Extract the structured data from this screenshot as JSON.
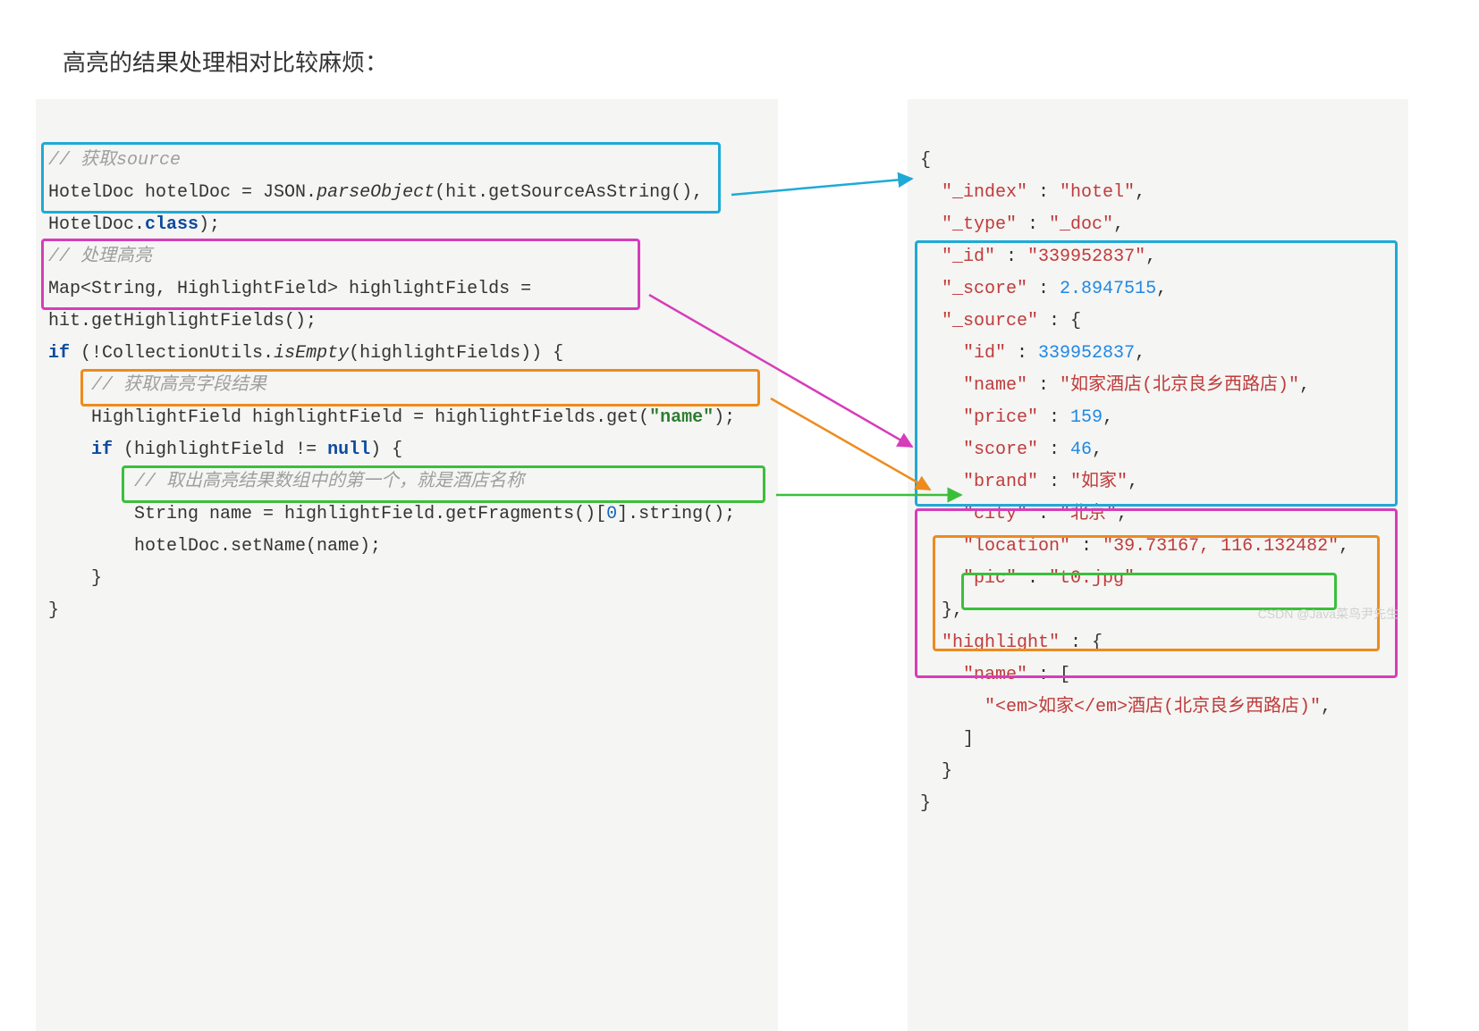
{
  "title": "高亮的结果处理相对比较麻烦：",
  "left": {
    "c1": "// 获取source",
    "l2a": "HotelDoc hotelDoc = JSON.",
    "l2b": "parseObject",
    "l2c": "(hit.getSourceAsString(),",
    "l3a": "HotelDoc.",
    "l3b": "class",
    "l3c": ");",
    "c2": "// 处理高亮",
    "l5": "Map<String, HighlightField> highlightFields =",
    "l6": "hit.getHighlightFields();",
    "l7a": "if",
    "l7b": " (!CollectionUtils.",
    "l7c": "isEmpty",
    "l7d": "(highlightFields)) {",
    "c3": "// 获取高亮字段结果",
    "l9a": "HighlightField highlightField = highlightFields.get(",
    "l9b": "\"name\"",
    "l9c": ");",
    "l10a": "if",
    "l10b": " (highlightField != ",
    "l10c": "null",
    "l10d": ") {",
    "c4": "// 取出高亮结果数组中的第一个，就是酒店名称",
    "l12a": "String name = highlightField.getFragments()[",
    "l12b": "0",
    "l12c": "].string();",
    "l13": "hotelDoc.setName(name);",
    "l14": "}",
    "l15": "}"
  },
  "right": {
    "open": "{",
    "index_k": "\"_index\"",
    "index_v": "\"hotel\"",
    "type_k": "\"_type\"",
    "type_v": "\"_doc\"",
    "id_k": "\"_id\"",
    "id_v": "\"339952837\"",
    "score_k": "\"_score\"",
    "score_v": "2.8947515",
    "source_k": "\"_source\"",
    "sid_k": "\"id\"",
    "sid_v": "339952837",
    "sname_k": "\"name\"",
    "sname_v": "\"如家酒店(北京良乡西路店)\"",
    "sprice_k": "\"price\"",
    "sprice_v": "159",
    "sscore_k": "\"score\"",
    "sscore_v": "46",
    "sbrand_k": "\"brand\"",
    "sbrand_v": "\"如家\"",
    "scity_k": "\"city\"",
    "scity_v": "\"北京\"",
    "sloc_k": "\"location\"",
    "sloc_v": "\"39.73167, 116.132482\"",
    "spic_k": "\"pic\"",
    "spic_v": "\"t0.jpg\"",
    "src_close": "},",
    "hl_k": "\"highlight\"",
    "hlname_k": "\"name\"",
    "hlval": "\"<em>如家</em>酒店(北京良乡西路店)\"",
    "close_br": "]",
    "close_obj": "}",
    "close_all": "}"
  },
  "watermark": "CSDN @Java菜鸟尹先生"
}
